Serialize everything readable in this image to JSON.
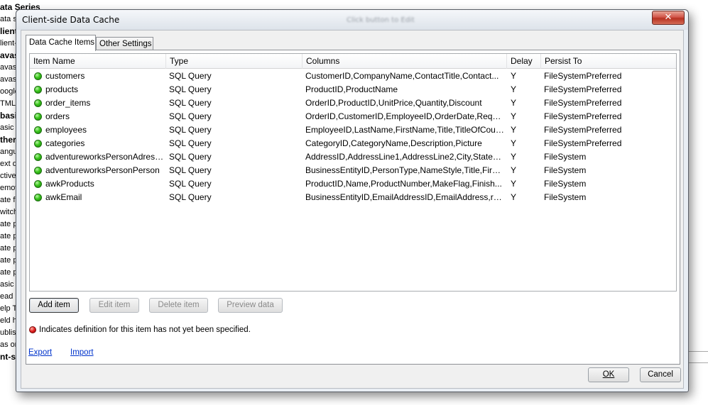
{
  "background": {
    "items": [
      {
        "text": "ata Series",
        "bold": true
      },
      {
        "text": "ata s",
        "bold": false
      },
      {
        "text": "lient",
        "bold": true
      },
      {
        "text": "lient-s",
        "bold": false
      },
      {
        "text": "avas",
        "bold": true
      },
      {
        "text": "avasc",
        "bold": false
      },
      {
        "text": "avasc",
        "bold": false
      },
      {
        "text": "oogle",
        "bold": false
      },
      {
        "text": "TML",
        "bold": false
      },
      {
        "text": "basi",
        "bold": true
      },
      {
        "text": "asic",
        "bold": false
      },
      {
        "text": "ther",
        "bold": true
      },
      {
        "text": "angu",
        "bold": false
      },
      {
        "text": "ext d",
        "bold": false
      },
      {
        "text": "ctive",
        "bold": false
      },
      {
        "text": "emov",
        "bold": false
      },
      {
        "text": "ate f",
        "bold": false
      },
      {
        "text": "witch",
        "bold": false
      },
      {
        "text": "ate p",
        "bold": false
      },
      {
        "text": "ate p",
        "bold": false
      },
      {
        "text": "ate p",
        "bold": false
      },
      {
        "text": "ate p",
        "bold": false
      },
      {
        "text": "ate p",
        "bold": false
      },
      {
        "text": "asic",
        "bold": false
      },
      {
        "text": "ead",
        "bold": false
      },
      {
        "text": "elp T",
        "bold": false
      },
      {
        "text": "eld h",
        "bold": false
      },
      {
        "text": "ublis",
        "bold": false
      },
      {
        "text": "as or",
        "bold": false
      },
      {
        "text": "nt-s",
        "bold": true
      }
    ]
  },
  "dialog": {
    "title": "Client-side Data Cache",
    "title_hint": "Click button to Edit",
    "close_glyph": "✕",
    "tabs": [
      {
        "label": "Data Cache Items",
        "active": true
      },
      {
        "label": "Other Settings",
        "active": false
      }
    ],
    "columns": [
      "Item Name",
      "Type",
      "Columns",
      "Delay",
      "Persist To"
    ],
    "rows": [
      {
        "name": "customers",
        "type": "SQL Query",
        "columns": "CustomerID,CompanyName,ContactTitle,Contact...",
        "delay": "Y",
        "persist": "FileSystemPreferred"
      },
      {
        "name": "products",
        "type": "SQL Query",
        "columns": "ProductID,ProductName",
        "delay": "Y",
        "persist": "FileSystemPreferred"
      },
      {
        "name": "order_items",
        "type": "SQL Query",
        "columns": "OrderID,ProductID,UnitPrice,Quantity,Discount",
        "delay": "Y",
        "persist": "FileSystemPreferred"
      },
      {
        "name": "orders",
        "type": "SQL Query",
        "columns": "OrderID,CustomerID,EmployeeID,OrderDate,Requir...",
        "delay": "Y",
        "persist": "FileSystemPreferred"
      },
      {
        "name": "employees",
        "type": "SQL Query",
        "columns": "EmployeeID,LastName,FirstName,Title,TitleOfCour...",
        "delay": "Y",
        "persist": "FileSystemPreferred"
      },
      {
        "name": "categories",
        "type": "SQL Query",
        "columns": "CategoryID,CategoryName,Description,Picture",
        "delay": "Y",
        "persist": "FileSystemPreferred"
      },
      {
        "name": "adventureworksPersonAdress...",
        "type": "SQL Query",
        "columns": "AddressID,AddressLine1,AddressLine2,City,StatePr...",
        "delay": "Y",
        "persist": "FileSystem"
      },
      {
        "name": "adventureworksPersonPerson",
        "type": "SQL Query",
        "columns": "BusinessEntityID,PersonType,NameStyle,Title,First...",
        "delay": "Y",
        "persist": "FileSystem"
      },
      {
        "name": "awkProducts",
        "type": "SQL Query",
        "columns": "ProductID,Name,ProductNumber,MakeFlag,Finish...",
        "delay": "Y",
        "persist": "FileSystem"
      },
      {
        "name": "awkEmail",
        "type": "SQL Query",
        "columns": "BusinessEntityID,EmailAddressID,EmailAddress,ro...",
        "delay": "Y",
        "persist": "FileSystem"
      }
    ],
    "buttons": {
      "add": "Add item",
      "edit": "Edit item",
      "delete": "Delete item",
      "preview": "Preview data"
    },
    "legend_text": "Indicates definition for this item has not yet been specified.",
    "links": {
      "export": "Export",
      "import": "Import"
    },
    "ok": "OK",
    "cancel": "Cancel"
  }
}
